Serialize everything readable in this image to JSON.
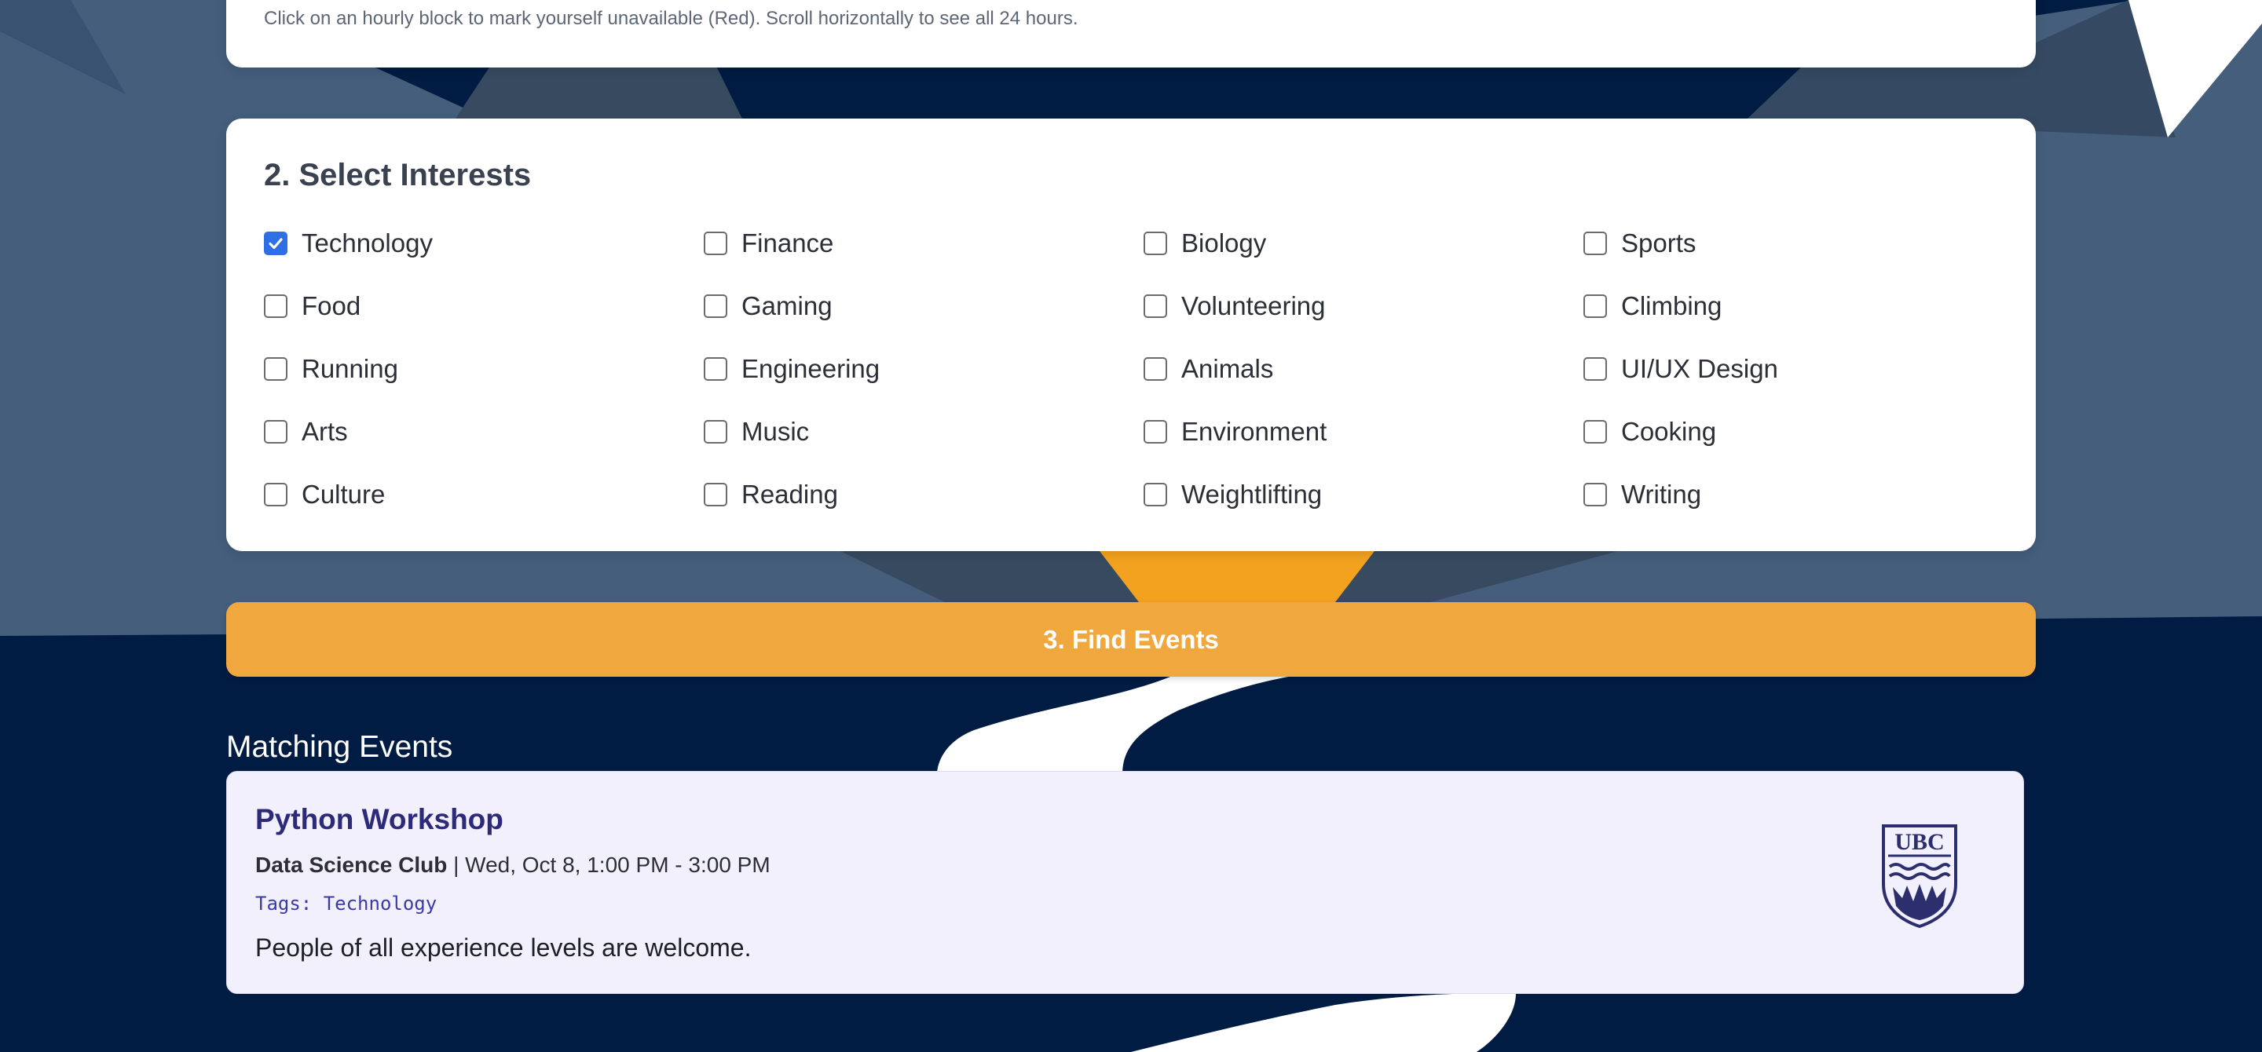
{
  "schedule": {
    "hint": "Click on an hourly block to mark yourself unavailable (Red). Scroll horizontally to see all 24 hours."
  },
  "interests": {
    "title": "2. Select Interests",
    "items": [
      {
        "label": "Technology",
        "checked": true
      },
      {
        "label": "Finance",
        "checked": false
      },
      {
        "label": "Biology",
        "checked": false
      },
      {
        "label": "Sports",
        "checked": false
      },
      {
        "label": "Food",
        "checked": false
      },
      {
        "label": "Gaming",
        "checked": false
      },
      {
        "label": "Volunteering",
        "checked": false
      },
      {
        "label": "Climbing",
        "checked": false
      },
      {
        "label": "Running",
        "checked": false
      },
      {
        "label": "Engineering",
        "checked": false
      },
      {
        "label": "Animals",
        "checked": false
      },
      {
        "label": "UI/UX Design",
        "checked": false
      },
      {
        "label": "Arts",
        "checked": false
      },
      {
        "label": "Music",
        "checked": false
      },
      {
        "label": "Environment",
        "checked": false
      },
      {
        "label": "Cooking",
        "checked": false
      },
      {
        "label": "Culture",
        "checked": false
      },
      {
        "label": "Reading",
        "checked": false
      },
      {
        "label": "Weightlifting",
        "checked": false
      },
      {
        "label": "Writing",
        "checked": false
      }
    ]
  },
  "find_button": {
    "label": "3. Find Events"
  },
  "results": {
    "title": "Matching Events",
    "events": [
      {
        "title": "Python Workshop",
        "club": "Data Science Club",
        "when": " | Wed, Oct 8, 1:00 PM - 3:00 PM",
        "tags": "Tags: Technology",
        "description": "People of all experience levels are welcome.",
        "logo_text": "UBC",
        "logo_icon": "ubc-crest-icon"
      }
    ]
  },
  "colors": {
    "accent_button": "#f0a73d",
    "checkbox_checked": "#2f6fe6",
    "event_title": "#2d2a7a",
    "page_background": "#011c42"
  }
}
